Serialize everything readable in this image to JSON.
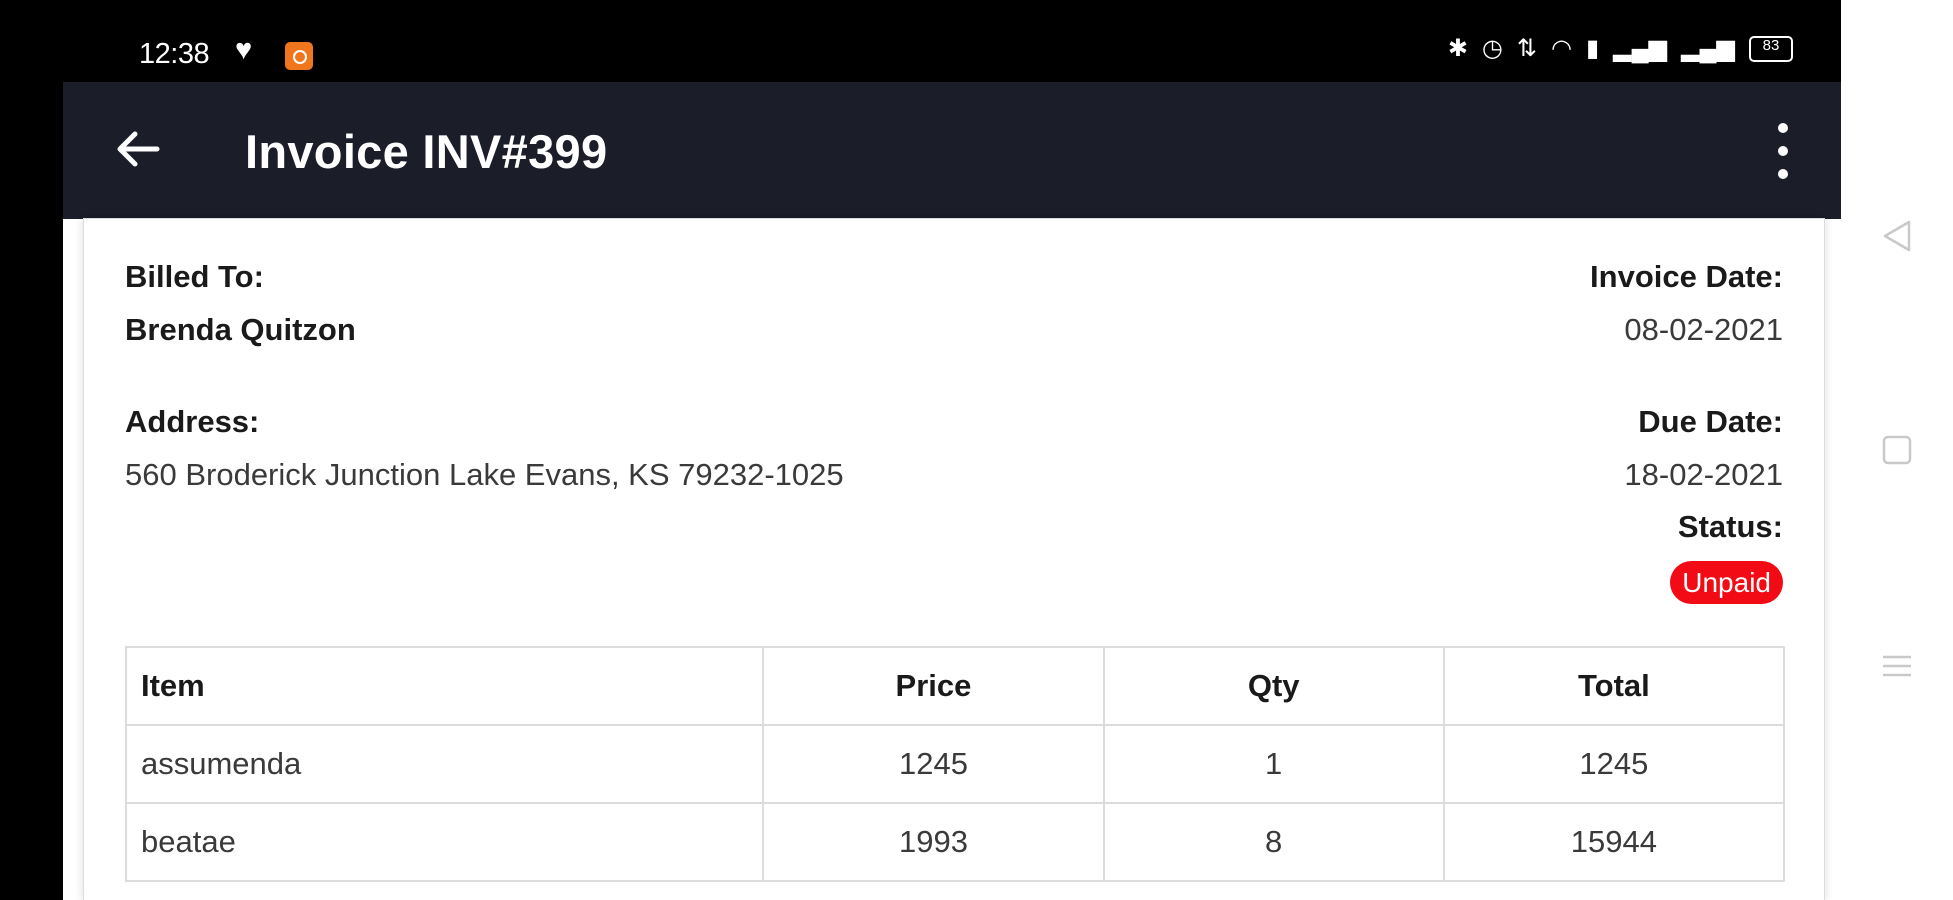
{
  "status_bar": {
    "time": "12:38",
    "battery": "83"
  },
  "app_bar": {
    "title": "Invoice INV#399"
  },
  "invoice": {
    "billed_to_label": "Billed To:",
    "billed_to_name": "Brenda Quitzon",
    "invoice_date_label": "Invoice Date:",
    "invoice_date": "08-02-2021",
    "address_label": "Address:",
    "address": "560 Broderick Junction Lake Evans, KS 79232-1025",
    "due_date_label": "Due Date:",
    "due_date": "18-02-2021",
    "status_label": "Status:",
    "status": "Unpaid",
    "status_color": "#f20a14"
  },
  "table": {
    "headers": {
      "item": "Item",
      "price": "Price",
      "qty": "Qty",
      "total": "Total"
    },
    "rows": [
      {
        "item": "assumenda",
        "price": "1245",
        "qty": "1",
        "total": "1245"
      },
      {
        "item": "beatae",
        "price": "1993",
        "qty": "8",
        "total": "15944"
      }
    ]
  },
  "colors": {
    "app_bar": "#1b1e29",
    "accent_badge": "#f20a14"
  },
  "icons": {
    "back": "arrow-left-icon",
    "more": "more-vert-icon",
    "nav_back": "triangle-back-icon",
    "nav_home": "square-home-icon",
    "nav_menu": "menu-lines-icon"
  }
}
